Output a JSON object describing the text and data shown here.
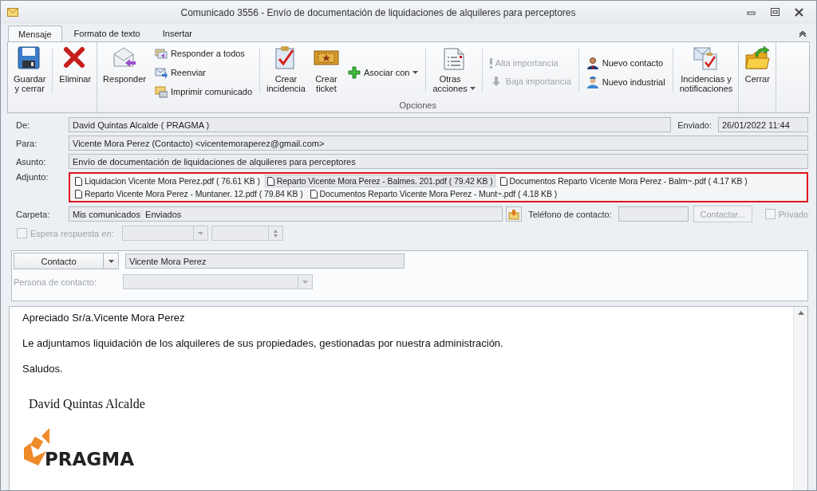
{
  "window": {
    "title": "Comunicado 3556 - Envío de documentación de liquidaciones de alquileres para perceptores"
  },
  "tabs": [
    {
      "label": "Mensaje",
      "selected": true
    },
    {
      "label": "Formato de texto",
      "selected": false
    },
    {
      "label": "Insertar",
      "selected": false
    }
  ],
  "ribbon": {
    "groups": [
      {
        "items": [
          {
            "kind": "large",
            "label": "Guardar\ny cerrar"
          },
          {
            "kind": "separator"
          },
          {
            "kind": "large",
            "label": "Eliminar"
          }
        ]
      },
      {
        "label": "Opciones",
        "items": [
          {
            "kind": "large",
            "label": "Responder"
          },
          {
            "kind": "stack",
            "items": [
              {
                "label": "Responder a todos",
                "disabled": false
              },
              {
                "label": "Reenviar",
                "disabled": false
              },
              {
                "label": "Imprimir comunicado",
                "disabled": false
              }
            ]
          },
          {
            "kind": "separator"
          },
          {
            "kind": "large",
            "label": "Crear\nincidencia"
          },
          {
            "kind": "large",
            "label": "Crear\nticket"
          },
          {
            "kind": "stack",
            "items": [
              {
                "label": "Asociar con",
                "disabled": false,
                "menu": true
              }
            ]
          },
          {
            "kind": "separator"
          },
          {
            "kind": "large",
            "label": "Otras\nacciones",
            "menu": true
          },
          {
            "kind": "separator"
          },
          {
            "kind": "stack",
            "items": [
              {
                "label": "Alta importancia",
                "disabled": true
              },
              {
                "label": "Baja importancia",
                "disabled": true
              }
            ]
          },
          {
            "kind": "separator"
          },
          {
            "kind": "stack",
            "items": [
              {
                "label": "Nuevo contacto",
                "disabled": false
              },
              {
                "label": "Nuevo industrial",
                "disabled": false
              }
            ]
          },
          {
            "kind": "separator"
          },
          {
            "kind": "large",
            "label": "Incidencias y\nnotificaciones"
          }
        ]
      },
      {
        "items": [
          {
            "kind": "large",
            "label": "Cerrar"
          }
        ]
      }
    ]
  },
  "header": {
    "from": {
      "label": "De:",
      "value": "David Quintas Alcalde ( PRAGMA )"
    },
    "sent": {
      "label": "Enviado:",
      "value": "26/01/2022 11:44"
    },
    "to": {
      "label": "Para:",
      "value": "Vicente Mora Perez (Contacto) <vicentemoraperez@gmail.com>"
    },
    "subject": {
      "label": "Asunto:",
      "value": "Envío de documentación de liquidaciones de alquileres para perceptores"
    },
    "attachments": {
      "label": "Adjunto:",
      "highlighted": true,
      "files": [
        {
          "name": "Liquidacion Vicente Mora Perez.pdf ( 76.61 KB )",
          "selected": false
        },
        {
          "name": "Reparto Vicente Mora Perez - Balmes. 201.pdf ( 79.42 KB )",
          "selected": true
        },
        {
          "name": "Documentos Reparto Vicente Mora Perez - Balm~.pdf ( 4.17 KB )",
          "selected": false
        },
        {
          "name": "Reparto Vicente Mora Perez - Muntaner. 12.pdf ( 79.84 KB )",
          "selected": false
        },
        {
          "name": "Documentos Reparto Vicente Mora Perez - Munt~.pdf ( 4.18 KB )",
          "selected": false
        }
      ]
    },
    "folder": {
      "label": "Carpeta:",
      "value": "Mis comunicados  Enviados"
    },
    "phone": {
      "label": "Teléfono de contacto:"
    },
    "contact_button": {
      "label": "Contactar...",
      "disabled": true
    },
    "private": {
      "label": "Privado",
      "checked": false,
      "disabled": true
    },
    "await_reply": {
      "label": "Espera respuesta en:",
      "checked": false,
      "disabled": true
    }
  },
  "contact_panel": {
    "type_button": {
      "label": "Contacto"
    },
    "name": {
      "value": "Vicente Mora Perez"
    },
    "person": {
      "label": "Persona de contacto:",
      "disabled": true
    }
  },
  "body": {
    "paragraphs": [
      "Apreciado Sr/a.Vicente Mora Perez",
      "Le adjuntamos liquidación de los alquileres de sus propiedades, gestionadas por nuestra administración.",
      "Saludos."
    ],
    "signature": "David Quintas Alcalde",
    "logo_text": "PRAGMA"
  }
}
